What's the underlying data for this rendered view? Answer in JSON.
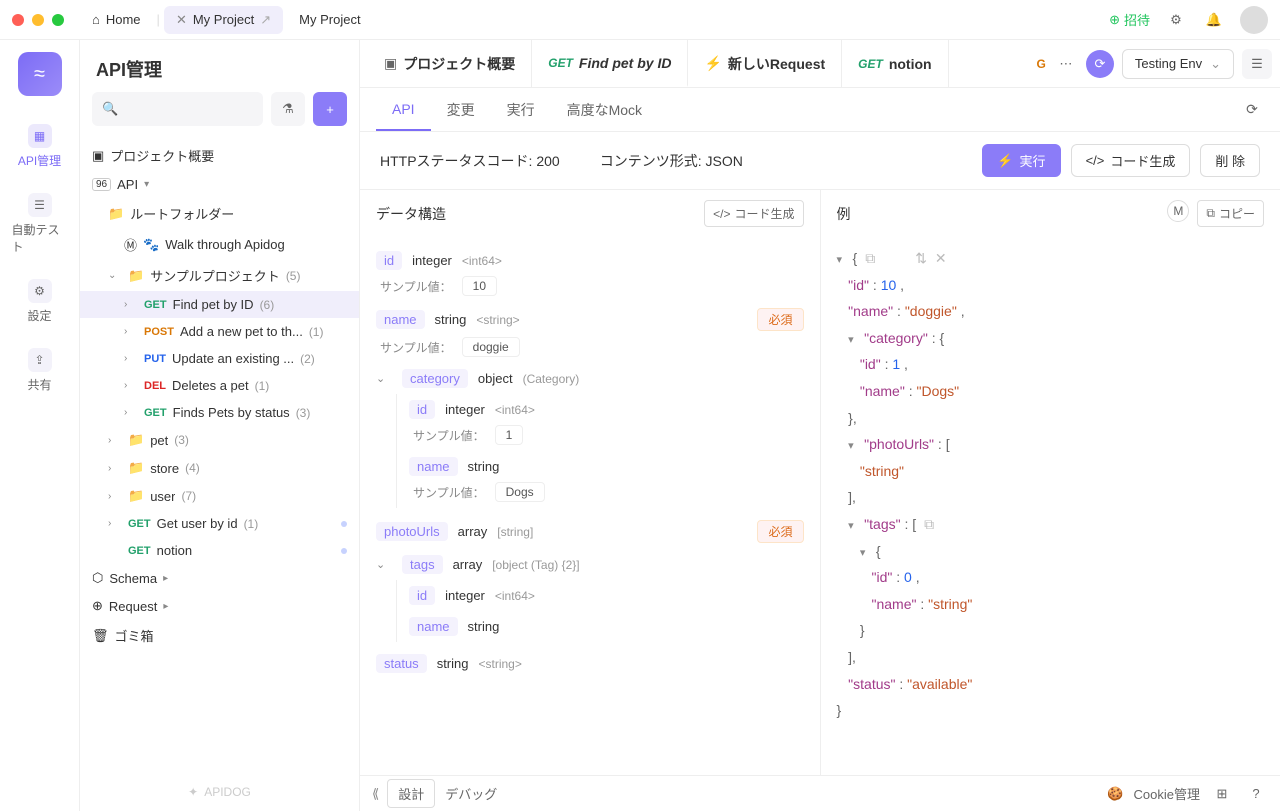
{
  "titlebar": {
    "home": "Home",
    "tabs": [
      {
        "label": "My Project",
        "active": true,
        "closable": true
      },
      {
        "label": "My Project",
        "active": false,
        "closable": false
      }
    ],
    "invite": "招待"
  },
  "rail": {
    "items": [
      {
        "label": "API管理",
        "active": true
      },
      {
        "label": "自動テスト",
        "active": false
      },
      {
        "label": "設定",
        "active": false
      },
      {
        "label": "共有",
        "active": false
      }
    ]
  },
  "sidebar": {
    "title": "API管理",
    "overview": "プロジェクト概要",
    "api_label": "API",
    "root_folder": "ルートフォルダー",
    "walk": "Walk through Apidog",
    "sample_project": "サンプルプロジェクト",
    "sample_count": "(5)",
    "endpoints": [
      {
        "method": "GET",
        "mclass": "m-get",
        "name": "Find pet by ID",
        "count": "(6)",
        "selected": true
      },
      {
        "method": "POST",
        "mclass": "m-post",
        "name": "Add a new pet to th...",
        "count": "(1)"
      },
      {
        "method": "PUT",
        "mclass": "m-put",
        "name": "Update an existing ...",
        "count": "(2)"
      },
      {
        "method": "DEL",
        "mclass": "m-del",
        "name": "Deletes a pet",
        "count": "(1)"
      },
      {
        "method": "GET",
        "mclass": "m-get",
        "name": "Finds Pets by status",
        "count": "(3)"
      }
    ],
    "folders": [
      {
        "name": "pet",
        "count": "(3)"
      },
      {
        "name": "store",
        "count": "(4)"
      },
      {
        "name": "user",
        "count": "(7)"
      }
    ],
    "loose": [
      {
        "method": "GET",
        "mclass": "m-get",
        "name": "Get user by id",
        "count": "(1)",
        "dot": true
      },
      {
        "method": "GET",
        "mclass": "m-get",
        "name": "notion",
        "count": "",
        "dot": true
      }
    ],
    "schema": "Schema",
    "request": "Request",
    "trash": "ゴミ箱",
    "brand": "APIDOG"
  },
  "ctabs": {
    "items": [
      {
        "icon": "▣",
        "title": "プロジェクト概要",
        "method": "",
        "active": false
      },
      {
        "icon": "",
        "title": "Find pet by ID",
        "method": "GET",
        "mclass": "m-get",
        "active": true,
        "italic": true
      },
      {
        "icon": "⚡",
        "title": "新しいRequest",
        "method": "",
        "active": false,
        "iconcolor": "#8b7cf8"
      },
      {
        "icon": "",
        "title": "notion",
        "method": "GET",
        "mclass": "m-get",
        "active": false
      }
    ],
    "g_badge": "G",
    "env": "Testing Env"
  },
  "subtabs": {
    "items": [
      "API",
      "変更",
      "実行",
      "高度なMock"
    ],
    "active": 0
  },
  "info": {
    "status": "HTTPステータスコード: 200",
    "content": "コンテンツ形式: JSON",
    "run": "実行",
    "gen": "コード生成",
    "del": "削 除"
  },
  "left_panel": {
    "title": "データ構造",
    "gen": "コード生成",
    "sample_label": "サンプル値：",
    "required": "必須",
    "fields": {
      "id": {
        "name": "id",
        "type": "integer",
        "sub": "<int64>",
        "sample": "10"
      },
      "name": {
        "name": "name",
        "type": "string",
        "sub": "<string>",
        "sample": "doggie",
        "required": true
      },
      "category": {
        "name": "category",
        "type": "object",
        "sub": "(Category)"
      },
      "cat_id": {
        "name": "id",
        "type": "integer",
        "sub": "<int64>",
        "sample": "1"
      },
      "cat_name": {
        "name": "name",
        "type": "string",
        "sample": "Dogs"
      },
      "photoUrls": {
        "name": "photoUrls",
        "type": "array",
        "sub": "[string]",
        "required": true
      },
      "tags": {
        "name": "tags",
        "type": "array",
        "sub": "[object (Tag) {2}]"
      },
      "tag_id": {
        "name": "id",
        "type": "integer",
        "sub": "<int64>"
      },
      "tag_name": {
        "name": "name",
        "type": "string"
      },
      "status": {
        "name": "status",
        "type": "string",
        "sub": "<string>"
      }
    }
  },
  "right_panel": {
    "title": "例",
    "copy": "コピー",
    "json": {
      "id_k": "\"id\"",
      "id_v": "10",
      "name_k": "\"name\"",
      "name_v": "\"doggie\"",
      "cat_k": "\"category\"",
      "cat_id_k": "\"id\"",
      "cat_id_v": "1",
      "cat_name_k": "\"name\"",
      "cat_name_v": "\"Dogs\"",
      "photo_k": "\"photoUrls\"",
      "photo_v": "\"string\"",
      "tags_k": "\"tags\"",
      "tag_id_k": "\"id\"",
      "tag_id_v": "0",
      "tag_name_k": "\"name\"",
      "tag_name_v": "\"string\"",
      "status_k": "\"status\"",
      "status_v": "\"available\""
    }
  },
  "bottom": {
    "design": "設計",
    "debug": "デバッグ",
    "cookie": "Cookie管理"
  }
}
